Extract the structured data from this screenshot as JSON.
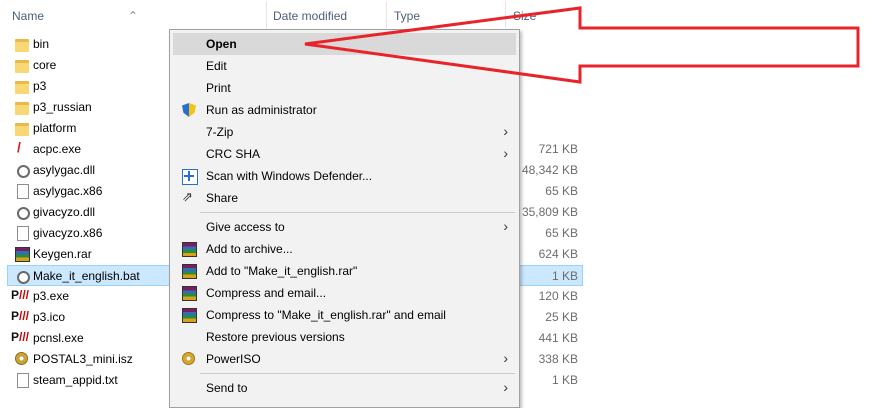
{
  "header": {
    "name": "Name",
    "date_modified": "Date modified",
    "type": "Type",
    "size": "Size"
  },
  "files": [
    {
      "name": "bin",
      "size": "",
      "icon": "folder-icon"
    },
    {
      "name": "core",
      "size": "",
      "icon": "folder-icon"
    },
    {
      "name": "p3",
      "size": "",
      "icon": "folder-icon"
    },
    {
      "name": "p3_russian",
      "size": "",
      "icon": "folder-icon"
    },
    {
      "name": "platform",
      "size": "",
      "icon": "folder-icon"
    },
    {
      "name": "acpc.exe",
      "size": "721 KB",
      "icon": "exe-icon"
    },
    {
      "name": "asylygac.dll",
      "size": "48,342 KB",
      "icon": "dll-icon"
    },
    {
      "name": "asylygac.x86",
      "size": "65 KB",
      "icon": "file-icon"
    },
    {
      "name": "givacyzo.dll",
      "size": "35,809 KB",
      "icon": "dll-icon"
    },
    {
      "name": "givacyzo.x86",
      "size": "65 KB",
      "icon": "file-icon"
    },
    {
      "name": "Keygen.rar",
      "size": "624 KB",
      "icon": "winrar-icon"
    },
    {
      "name": "Make_it_english.bat",
      "size": "1 KB",
      "icon": "batch-icon"
    },
    {
      "name": "p3.exe",
      "size": "120 KB",
      "icon": "postal-icon"
    },
    {
      "name": "p3.ico",
      "size": "25 KB",
      "icon": "postal-icon"
    },
    {
      "name": "pcnsl.exe",
      "size": "441 KB",
      "icon": "postal-icon"
    },
    {
      "name": "POSTAL3_mini.isz",
      "size": "338 KB",
      "icon": "disc-icon"
    },
    {
      "name": "steam_appid.txt",
      "size": "1 KB",
      "icon": "text-file-icon"
    }
  ],
  "menu": {
    "open": "Open",
    "edit": "Edit",
    "print": "Print",
    "run_as_admin": "Run as administrator",
    "seven_zip": "7-Zip",
    "crc_sha": "CRC SHA",
    "scan_defender": "Scan with Windows Defender...",
    "share": "Share",
    "give_access": "Give access to",
    "add_archive": "Add to archive...",
    "add_rar": "Add to \"Make_it_english.rar\"",
    "compress_email": "Compress and email...",
    "compress_rar_email": "Compress to \"Make_it_english.rar\" and email",
    "restore_versions": "Restore previous versions",
    "poweriso": "PowerISO",
    "send_to": "Send to"
  },
  "colors": {
    "selection": "#cce8ff",
    "highlight": "#d9d9d9",
    "annotation": "#e8232a"
  }
}
